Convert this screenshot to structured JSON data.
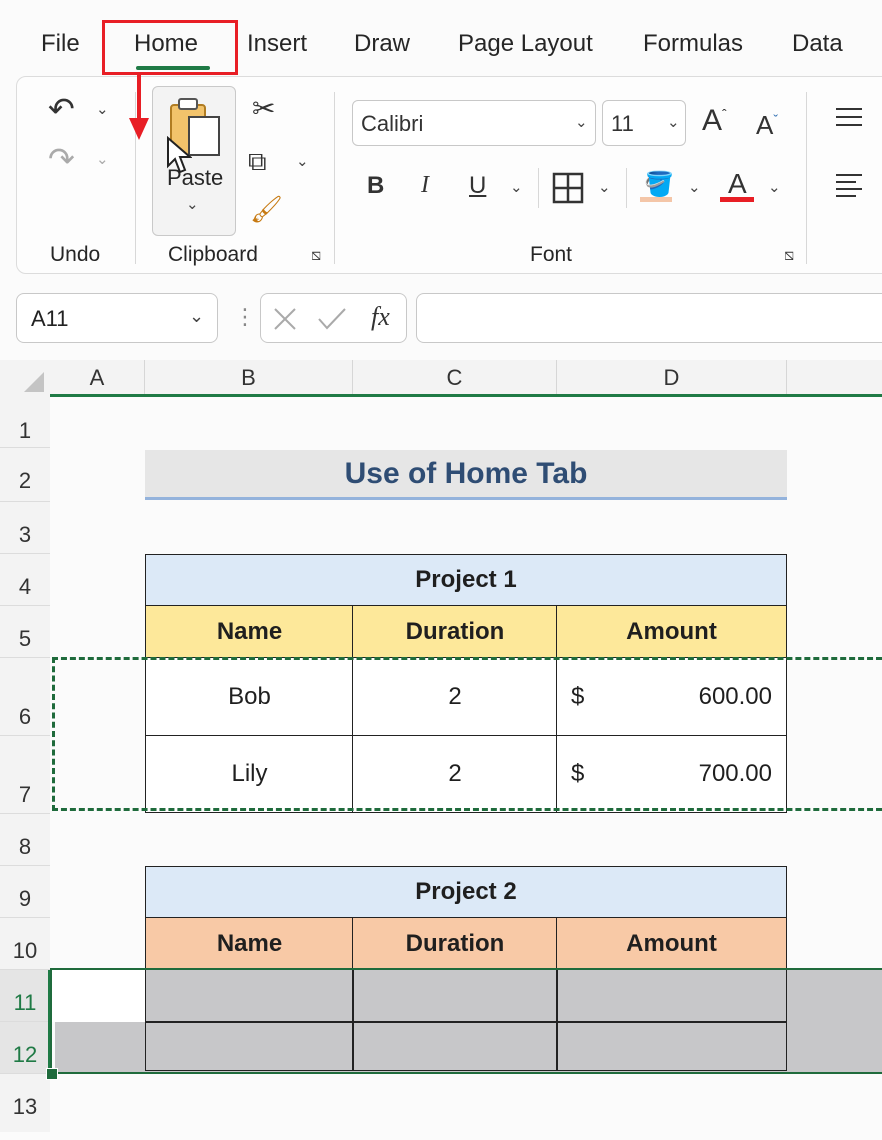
{
  "menu": {
    "tabs": [
      "File",
      "Home",
      "Insert",
      "Draw",
      "Page Layout",
      "Formulas",
      "Data"
    ]
  },
  "ribbon": {
    "groups": {
      "undo": "Undo",
      "clipboard": "Clipboard",
      "font": "Font"
    },
    "paste_label": "Paste",
    "font_name": "Calibri",
    "font_size": "11"
  },
  "formula_bar": {
    "name_box": "A11",
    "fx": "fx",
    "value": ""
  },
  "columns": [
    "A",
    "B",
    "C",
    "D"
  ],
  "rows": [
    "1",
    "2",
    "3",
    "4",
    "5",
    "6",
    "7",
    "8",
    "9",
    "10",
    "11",
    "12",
    "13"
  ],
  "sheet": {
    "title": "Use of Home Tab",
    "project1": {
      "title": "Project 1",
      "headers": [
        "Name",
        "Duration",
        "Amount"
      ],
      "rows": [
        {
          "name": "Bob",
          "duration": "2",
          "currency": "$",
          "amount": "600.00"
        },
        {
          "name": "Lily",
          "duration": "2",
          "currency": "$",
          "amount": "700.00"
        }
      ]
    },
    "project2": {
      "title": "Project 2",
      "headers": [
        "Name",
        "Duration",
        "Amount"
      ]
    }
  },
  "colors": {
    "accent_green": "#1f7a45",
    "highlight_red": "#e81e25",
    "project1_title_bg": "#dce9f7",
    "project1_header_bg": "#fde89a",
    "project2_title_bg": "#dce9f7",
    "project2_header_bg": "#f8c9a6",
    "selection_gray": "#c7c7c9"
  }
}
